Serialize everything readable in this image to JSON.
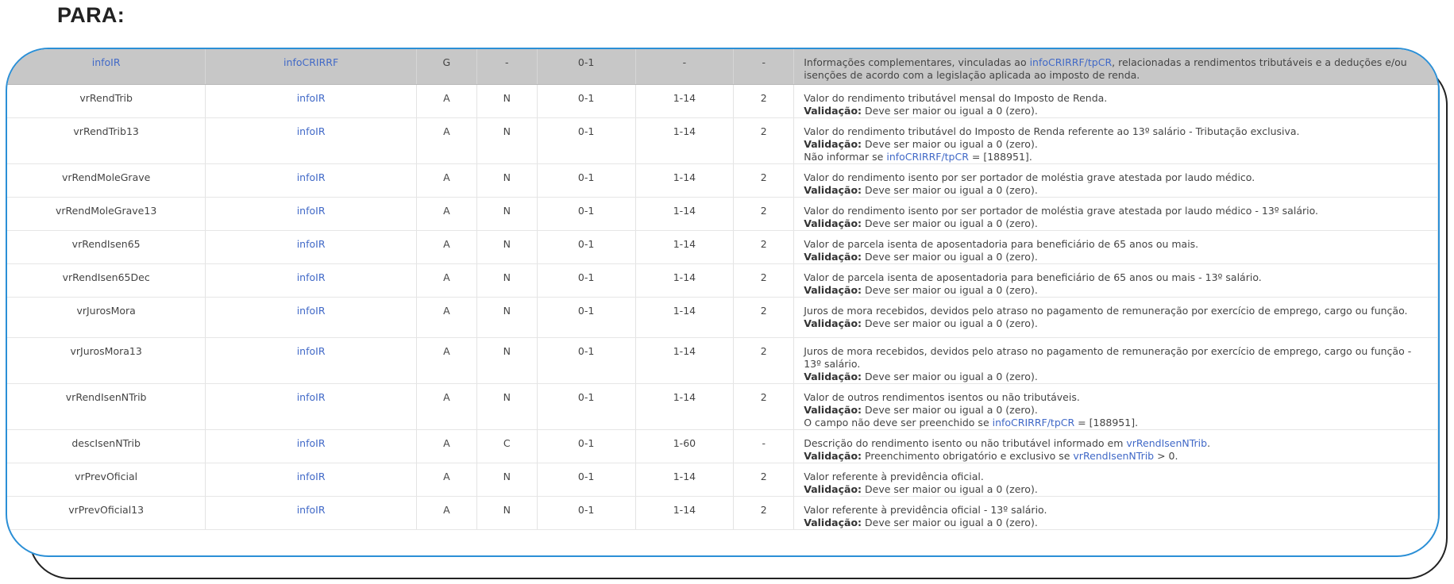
{
  "heading": "PARA:",
  "header": {
    "name": "infoIR",
    "parent": "infoCRIRRF",
    "elem": "G",
    "tipo": "-",
    "ocor": "0-1",
    "tam": "-",
    "dec": "-",
    "desc": [
      {
        "t": "Informações complementares, vinculadas ao "
      },
      {
        "t": "infoCRIRRF/tpCR",
        "link": true
      },
      {
        "t": ", relacionadas a rendimentos tributáveis e a deduções e/ou isenções de acordo com a legislação aplicada ao imposto de renda."
      }
    ]
  },
  "rows": [
    {
      "name": "vrRendTrib",
      "parent": "infoIR",
      "elem": "A",
      "tipo": "N",
      "ocor": "0-1",
      "tam": "1-14",
      "dec": "2",
      "desc": [
        [
          {
            "t": "Valor do rendimento tributável mensal do Imposto de Renda."
          }
        ],
        [
          {
            "t": "Validação:",
            "bold": true
          },
          {
            "t": " Deve ser maior ou igual a 0 (zero)."
          }
        ]
      ]
    },
    {
      "name": "vrRendTrib13",
      "parent": "infoIR",
      "elem": "A",
      "tipo": "N",
      "ocor": "0-1",
      "tam": "1-14",
      "dec": "2",
      "desc": [
        [
          {
            "t": "Valor do rendimento tributável do Imposto de Renda referente ao 13º salário - Tributação exclusiva."
          }
        ],
        [
          {
            "t": "Validação:",
            "bold": true
          },
          {
            "t": " Deve ser maior ou igual a 0 (zero)."
          }
        ],
        [
          {
            "t": "Não informar se "
          },
          {
            "t": "infoCRIRRF/tpCR",
            "link": true
          },
          {
            "t": " = [188951]."
          }
        ]
      ]
    },
    {
      "name": "vrRendMoleGrave",
      "parent": "infoIR",
      "elem": "A",
      "tipo": "N",
      "ocor": "0-1",
      "tam": "1-14",
      "dec": "2",
      "desc": [
        [
          {
            "t": "Valor do rendimento isento por ser portador de moléstia grave atestada por laudo médico."
          }
        ],
        [
          {
            "t": "Validação:",
            "bold": true
          },
          {
            "t": " Deve ser maior ou igual a 0 (zero)."
          }
        ]
      ]
    },
    {
      "name": "vrRendMoleGrave13",
      "parent": "infoIR",
      "elem": "A",
      "tipo": "N",
      "ocor": "0-1",
      "tam": "1-14",
      "dec": "2",
      "desc": [
        [
          {
            "t": "Valor do rendimento isento por ser portador de moléstia grave atestada por laudo médico - 13º salário."
          }
        ],
        [
          {
            "t": "Validação:",
            "bold": true
          },
          {
            "t": " Deve ser maior ou igual a 0 (zero)."
          }
        ]
      ]
    },
    {
      "name": "vrRendIsen65",
      "parent": "infoIR",
      "elem": "A",
      "tipo": "N",
      "ocor": "0-1",
      "tam": "1-14",
      "dec": "2",
      "desc": [
        [
          {
            "t": "Valor de parcela isenta de aposentadoria para beneficiário de 65 anos ou mais."
          }
        ],
        [
          {
            "t": "Validação:",
            "bold": true
          },
          {
            "t": " Deve ser maior ou igual a 0 (zero)."
          }
        ]
      ]
    },
    {
      "name": "vrRendIsen65Dec",
      "parent": "infoIR",
      "elem": "A",
      "tipo": "N",
      "ocor": "0-1",
      "tam": "1-14",
      "dec": "2",
      "desc": [
        [
          {
            "t": "Valor de parcela isenta de aposentadoria para beneficiário de 65 anos ou mais - 13º salário."
          }
        ],
        [
          {
            "t": "Validação:",
            "bold": true
          },
          {
            "t": " Deve ser maior ou igual a 0 (zero)."
          }
        ]
      ]
    },
    {
      "name": "vrJurosMora",
      "parent": "infoIR",
      "elem": "A",
      "tipo": "N",
      "ocor": "0-1",
      "tam": "1-14",
      "dec": "2",
      "desc": [
        [
          {
            "t": "Juros de mora recebidos, devidos pelo atraso no pagamento de remuneração por exercício de emprego, cargo ou função."
          }
        ],
        [
          {
            "t": "Validação:",
            "bold": true
          },
          {
            "t": " Deve ser maior ou igual a 0 (zero)."
          }
        ]
      ]
    },
    {
      "name": "vrJurosMora13",
      "parent": "infoIR",
      "elem": "A",
      "tipo": "N",
      "ocor": "0-1",
      "tam": "1-14",
      "dec": "2",
      "desc": [
        [
          {
            "t": "Juros de mora recebidos, devidos pelo atraso no pagamento de remuneração por exercício de emprego, cargo ou função - 13º salário."
          }
        ],
        [
          {
            "t": "Validação:",
            "bold": true
          },
          {
            "t": " Deve ser maior ou igual a 0 (zero)."
          }
        ]
      ]
    },
    {
      "name": "vrRendIsenNTrib",
      "parent": "infoIR",
      "elem": "A",
      "tipo": "N",
      "ocor": "0-1",
      "tam": "1-14",
      "dec": "2",
      "desc": [
        [
          {
            "t": "Valor de outros rendimentos isentos ou não tributáveis."
          }
        ],
        [
          {
            "t": "Validação:",
            "bold": true
          },
          {
            "t": " Deve ser maior ou igual a 0 (zero)."
          }
        ],
        [
          {
            "t": "O campo não deve ser preenchido se "
          },
          {
            "t": "infoCRIRRF/tpCR",
            "link": true
          },
          {
            "t": " = [188951]."
          }
        ]
      ]
    },
    {
      "name": "descIsenNTrib",
      "parent": "infoIR",
      "elem": "A",
      "tipo": "C",
      "ocor": "0-1",
      "tam": "1-60",
      "dec": "-",
      "desc": [
        [
          {
            "t": "Descrição do rendimento isento ou não tributável informado em "
          },
          {
            "t": "vrRendIsenNTrib",
            "link": true
          },
          {
            "t": "."
          }
        ],
        [
          {
            "t": "Validação:",
            "bold": true
          },
          {
            "t": " Preenchimento obrigatório e exclusivo se "
          },
          {
            "t": "vrRendIsenNTrib",
            "link": true
          },
          {
            "t": " > 0."
          }
        ]
      ]
    },
    {
      "name": "vrPrevOficial",
      "parent": "infoIR",
      "elem": "A",
      "tipo": "N",
      "ocor": "0-1",
      "tam": "1-14",
      "dec": "2",
      "desc": [
        [
          {
            "t": "Valor referente à previdência oficial."
          }
        ],
        [
          {
            "t": "Validação:",
            "bold": true
          },
          {
            "t": " Deve ser maior ou igual a 0 (zero)."
          }
        ]
      ]
    },
    {
      "name": "vrPrevOficial13",
      "parent": "infoIR",
      "elem": "A",
      "tipo": "N",
      "ocor": "0-1",
      "tam": "1-14",
      "dec": "2",
      "desc": [
        [
          {
            "t": "Valor referente à previdência oficial - 13º salário."
          }
        ],
        [
          {
            "t": "Validação:",
            "bold": true
          },
          {
            "t": " Deve ser maior ou igual a 0 (zero)."
          }
        ]
      ]
    }
  ]
}
